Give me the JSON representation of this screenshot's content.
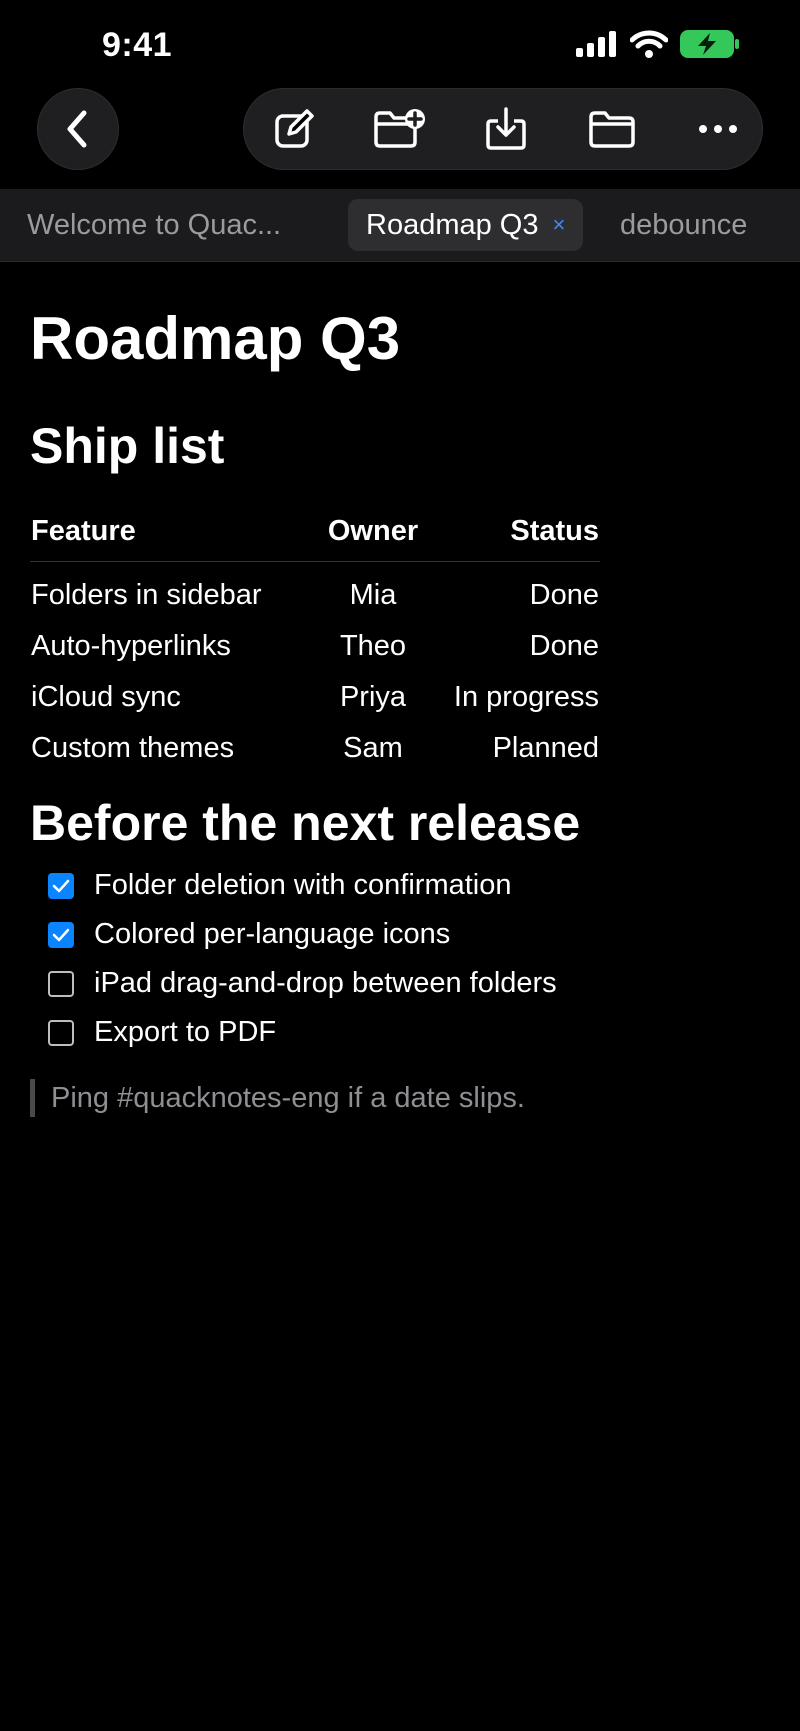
{
  "status_bar": {
    "time": "9:41"
  },
  "tabs": [
    {
      "label": "Welcome to Quac..."
    },
    {
      "label": "Roadmap Q3",
      "close": "×"
    },
    {
      "label": "debounce"
    }
  ],
  "document": {
    "title": "Roadmap Q3",
    "ship_list": {
      "heading": "Ship list",
      "columns": [
        "Feature",
        "Owner",
        "Status"
      ],
      "rows": [
        [
          "Folders in sidebar",
          "Mia",
          "Done"
        ],
        [
          "Auto-hyperlinks",
          "Theo",
          "Done"
        ],
        [
          "iCloud sync",
          "Priya",
          "In progress"
        ],
        [
          "Custom themes",
          "Sam",
          "Planned"
        ]
      ]
    },
    "release": {
      "heading": "Before the next release",
      "tasks": [
        {
          "label": "Folder deletion with confirmation",
          "checked": true
        },
        {
          "label": "Colored per-language icons",
          "checked": true
        },
        {
          "label": "iPad drag-and-drop between folders",
          "checked": false
        },
        {
          "label": "Export to PDF",
          "checked": false
        }
      ]
    },
    "note": "Ping #quacknotes-eng if a date slips."
  },
  "colors": {
    "accent": "#0a84ff",
    "battery": "#34c759",
    "background": "#000000"
  },
  "icons": {
    "back": "chevron-left-icon",
    "new_note": "compose-icon",
    "new_folder": "folder-plus-icon",
    "import": "download-tray-icon",
    "folder": "folder-icon",
    "more": "ellipsis-icon"
  }
}
